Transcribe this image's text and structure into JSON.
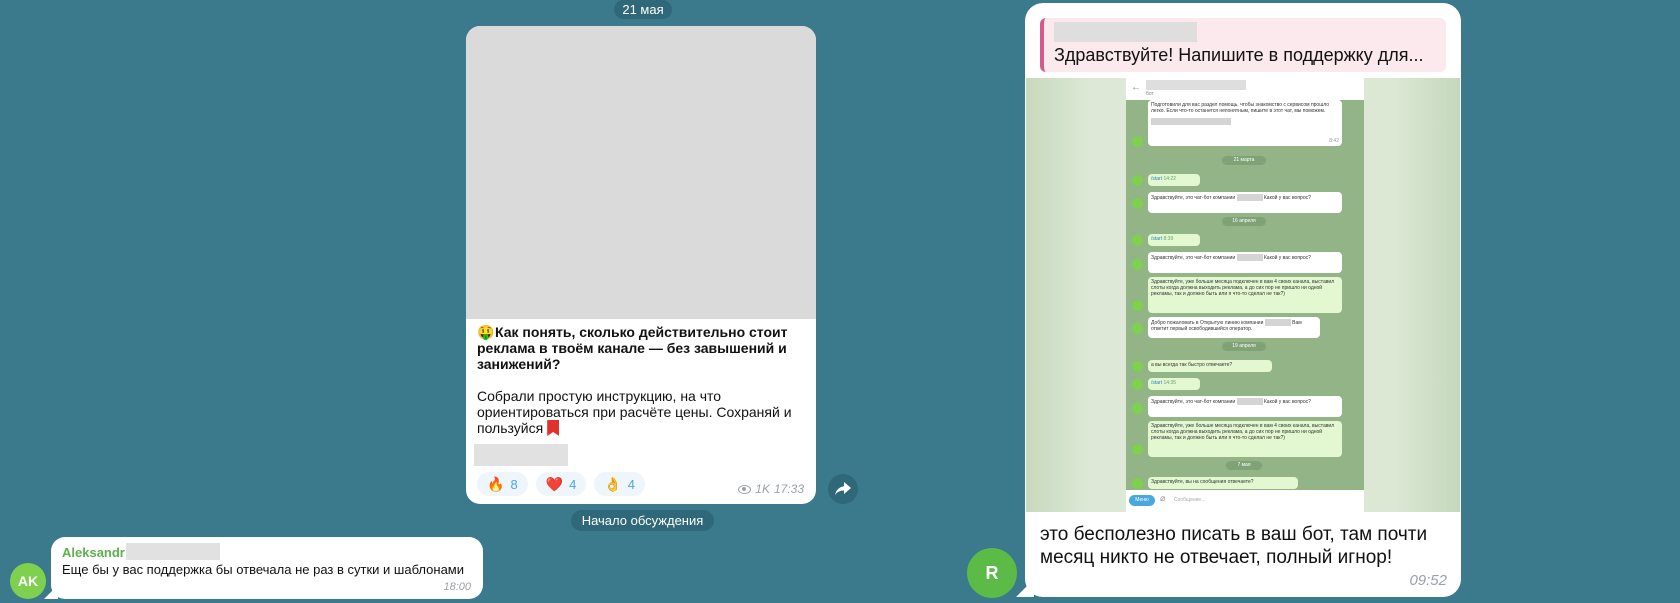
{
  "date_divider": "21 мая",
  "channel_post": {
    "title_emoji": "🤑",
    "title": "Как понять, сколько действительно стоит реклама в твоём канале — без завышений и занижений?",
    "body": "Собрали простую инструкцию, на что ориентироваться при расчёте цены. Сохраняй и пользуйся",
    "reactions": [
      {
        "icon": "🔥",
        "count": "8"
      },
      {
        "icon": "❤️",
        "count": "4"
      },
      {
        "icon": "👌",
        "count": "4"
      }
    ],
    "views": "1K",
    "time": "17:33"
  },
  "discussion_divider": "Начало обсуждения",
  "comment_left": {
    "avatar": "AK",
    "sender": "Aleksandr",
    "text": "Еще бы у вас поддержка бы отвечала не раз в сутки и шаблонами",
    "time": "18:00"
  },
  "comment_right": {
    "avatar": "R",
    "quote_text": "Здравствуйте! Напишите в поддержку для...",
    "text": "это бесполезно писать в ваш бот, там почти месяц никто не отвечает, полный игнор!",
    "time": "09:52"
  },
  "embedded_screenshot": {
    "header_sub": "бот",
    "intro": "Подготовили для вас раздел помощь, чтобы знакомство с сервисом прошло легко. Если что-то останется непонятным, пишите в этот чат, мы поможем.",
    "intro_time": "8:42",
    "dates": [
      "21 марта",
      "16 апреля",
      "19 апреля",
      "7 мая"
    ],
    "start_cmd": "/start",
    "greeting": "Здравствуйте, это чат-бот компании",
    "greeting_tail": "Какой у вас вопрос?",
    "complaint": "Здравствуйте, уже больше месяца подключен в вам 4 своих канала, выставил слоты когда должна выходить реклама, а до сих пор не пришло ни одной рекламы, так и должно быть или я что-то сделал не так?)",
    "welcome": "Добро пожаловать в Открытую линию компании",
    "welcome_tail": "Вам ответит первый освободившийся оператор.",
    "always_fast": "а вы всегда так быстро отвечаете?",
    "answer_q": "Здравствуйте, вы на сообщения отвечаете?",
    "times": {
      "t1": "14:22",
      "t2": "14:22",
      "t3": "8:39",
      "t4": "8:39",
      "t5": "8:40",
      "t6": "8:40",
      "t7": "8:42",
      "t8": "14:35",
      "t9": "14:35",
      "t10": "14:35",
      "t11": "9:36"
    },
    "menu_label": "Меню",
    "input_placeholder": "Сообщение..."
  }
}
